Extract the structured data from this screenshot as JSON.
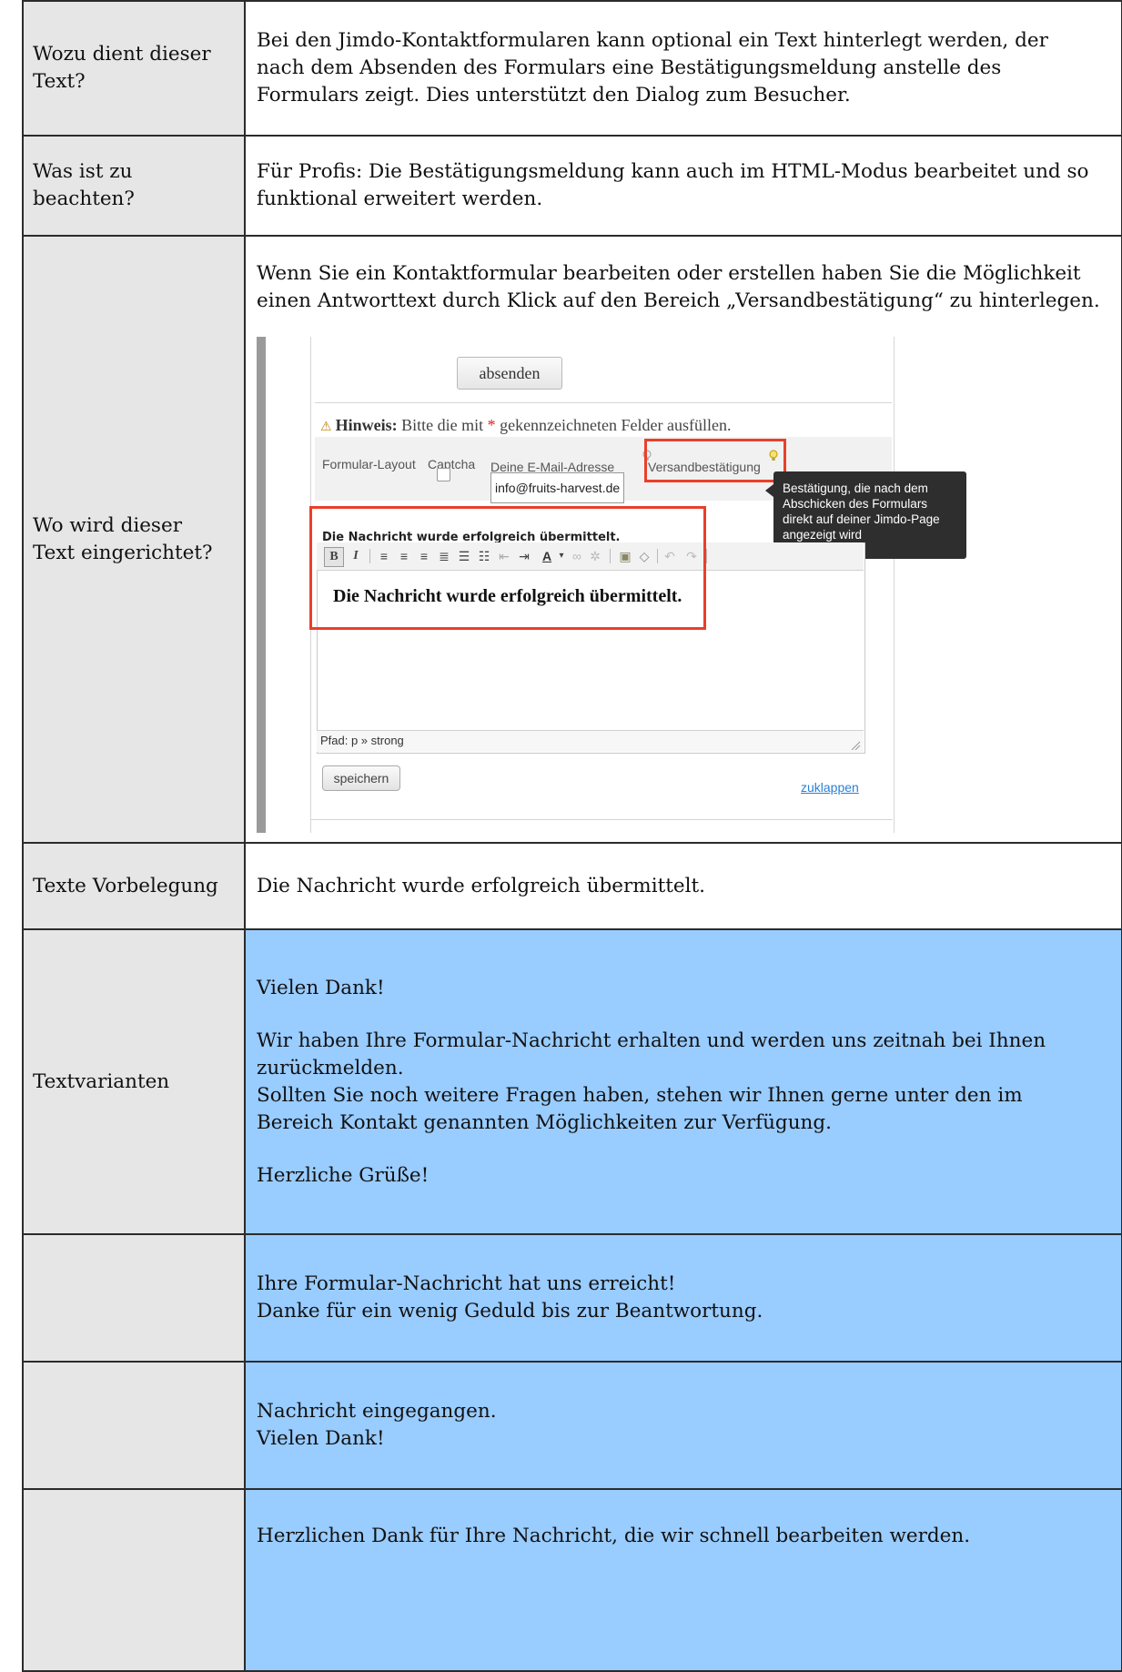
{
  "rows": [
    {
      "label": "Wozu dient dieser Text?",
      "text": "Bei den Jimdo-Kontaktformularen kann optional ein Text hinterlegt werden, der nach dem Absenden des Formulars eine Bestätigungsmeldung anstelle des Formulars zeigt. Dies unterstützt den Dialog zum Besucher."
    },
    {
      "label": "Was ist zu beachten?",
      "text": "Für Profis: Die Bestätigungsmeldung kann auch im HTML-Modus bearbeitet und so funktional erweitert werden."
    },
    {
      "label": "Wo wird dieser Text eingerichtet?",
      "text": "Wenn Sie ein Kontaktformular bearbeiten oder erstellen haben Sie die Möglichkeit einen Antworttext durch Klick auf den Bereich „Versandbestätigung“ zu hinterlegen."
    },
    {
      "label": "Texte Vorbelegung",
      "text": "Die Nachricht wurde erfolgreich übermittelt."
    },
    {
      "label": "Textvarianten",
      "lines": [
        "Vielen Dank!",
        "Wir haben Ihre Formular-Nachricht erhalten und werden uns zeitnah bei Ihnen zurückmelden.",
        "Sollten Sie noch weitere Fragen haben, stehen wir Ihnen gerne unter den im Bereich Kontakt genannten Möglichkeiten zur Verfügung.",
        "Herzliche Grüße!"
      ]
    },
    {
      "label": "",
      "lines": [
        "Ihre Formular-Nachricht hat uns erreicht!",
        "Danke für ein wenig Geduld bis zur Beantwortung."
      ]
    },
    {
      "label": "",
      "lines": [
        "Nachricht eingegangen.",
        "Vielen Dank!"
      ]
    },
    {
      "label": "",
      "lines": [
        "Herzlichen Dank für Ihre Nachricht, die wir schnell bearbeiten werden."
      ]
    }
  ],
  "screenshot": {
    "submit_label": "absenden",
    "hint_bold": "Hinweis:",
    "hint_pre": "Bitte die mit",
    "hint_star": "*",
    "hint_post": "gekennzeichneten Felder ausfüllen.",
    "tab_layout": "Formular-Layout",
    "tab_captcha": "Captcha",
    "tab_email": "Deine E-Mail-Adresse",
    "email_value": "info@fruits-harvest.de",
    "tab_confirm": "Versandbestätigung",
    "tooltip": "Bestätigung, die nach dem Abschicken des Formulars direkt auf deiner Jimdo-Page angezeigt wird",
    "editor_title": "Die Nachricht wurde erfolgreich übermittelt.",
    "editor_body": "Die Nachricht wurde erfolgreich übermittelt.",
    "path": "Pfad: p » strong",
    "save_label": "speichern",
    "collapse_label": "zuklappen",
    "accent_red": "#e8402a",
    "link_blue": "#2a7fd4"
  },
  "colors": {
    "label_bg": "#e6e6e6",
    "variant_bg": "#99ccff"
  }
}
